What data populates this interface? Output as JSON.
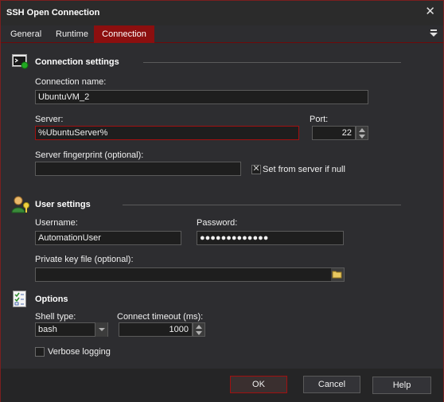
{
  "window": {
    "title": "SSH Open Connection",
    "close_glyph": "✕"
  },
  "tabs": [
    {
      "label": "General",
      "active": false
    },
    {
      "label": "Runtime",
      "active": false
    },
    {
      "label": "Connection",
      "active": true
    }
  ],
  "connection_settings": {
    "heading": "Connection settings",
    "icon": "terminal-icon",
    "name_label": "Connection name:",
    "name_value": "UbuntuVM_2",
    "server_label": "Server:",
    "server_value": "%UbuntuServer%",
    "port_label": "Port:",
    "port_value": "22",
    "fingerprint_label": "Server fingerprint (optional):",
    "fingerprint_value": "",
    "set_from_server_label": "Set from server if null",
    "set_from_server_checked": true
  },
  "user_settings": {
    "heading": "User settings",
    "icon": "user-key-icon",
    "username_label": "Username:",
    "username_value": "AutomationUser",
    "password_label": "Password:",
    "password_value": "●●●●●●●●●●●●●",
    "private_key_label": "Private key file (optional):",
    "private_key_value": ""
  },
  "options": {
    "heading": "Options",
    "icon": "checklist-icon",
    "shell_type_label": "Shell type:",
    "shell_type_value": "bash",
    "timeout_label": "Connect timeout (ms):",
    "timeout_value": "1000",
    "verbose_label": "Verbose logging",
    "verbose_checked": false
  },
  "buttons": {
    "ok": "OK",
    "cancel": "Cancel",
    "help": "Help"
  },
  "colors": {
    "accent": "#8c0f0f",
    "background": "#2d2d30",
    "input_bg": "#1e1e1e"
  }
}
